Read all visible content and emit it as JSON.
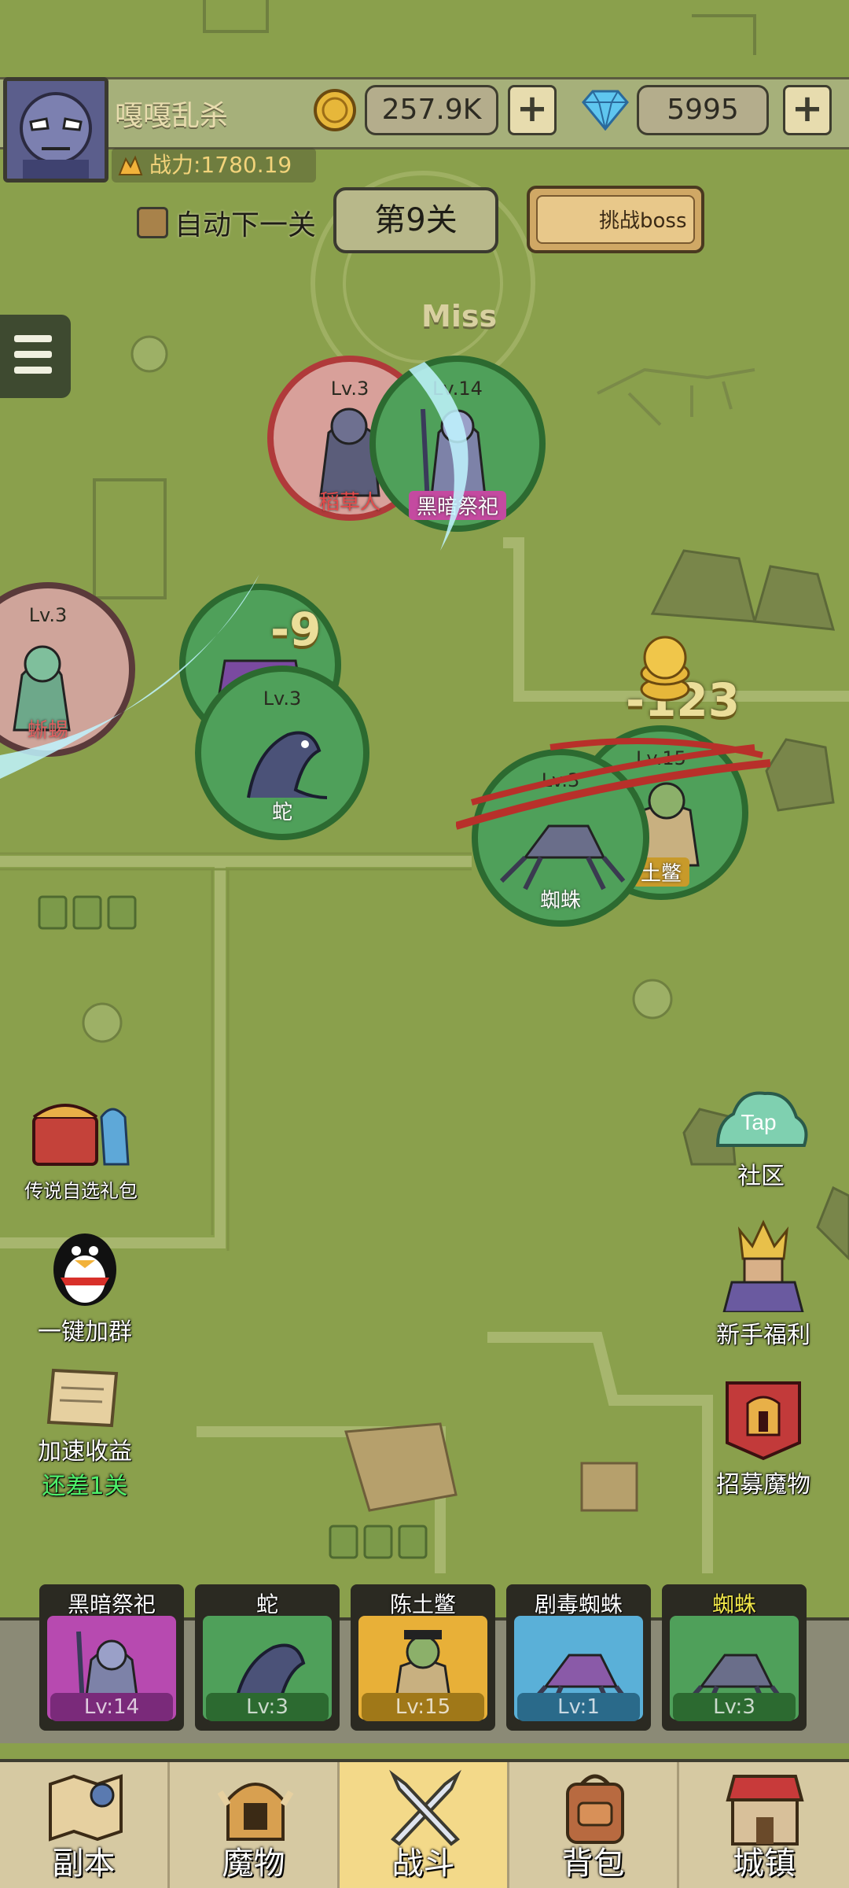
{
  "player": {
    "name": "嘎嘎乱杀",
    "power": "战力:1780.19",
    "coins": "257.9K",
    "gems": "5995",
    "plus": "+"
  },
  "stage": {
    "auto_next": "自动下一关",
    "current": "第9关",
    "boss_button": "挑战boss",
    "miss_text": "Miss"
  },
  "battle": {
    "monsters": [
      {
        "lv": "Lv.3",
        "name": "稻草人"
      },
      {
        "lv": "Lv.14",
        "name": "黑暗祭祀"
      },
      {
        "lv": "Lv.3",
        "name": "蜥蜴"
      },
      {
        "lv": "Lv.3",
        "name": "蛇"
      },
      {
        "lv": "Lv.15",
        "name": "土鳖"
      },
      {
        "lv": "Lv.3",
        "name": "蜘蛛"
      }
    ],
    "damage": [
      "-9",
      "-123"
    ]
  },
  "side_left": [
    {
      "label": "传说自选礼包"
    },
    {
      "label": "一键加群"
    },
    {
      "label": "加速收益",
      "sub": "还差1关"
    }
  ],
  "side_right": [
    {
      "label": "社区",
      "badge": "Tap"
    },
    {
      "label": "新手福利"
    },
    {
      "label": "招募魔物"
    }
  ],
  "team": [
    {
      "name": "黑暗祭祀",
      "lv": "Lv:14"
    },
    {
      "name": "蛇",
      "lv": "Lv:3"
    },
    {
      "name": "陈土鳖",
      "lv": "Lv:15"
    },
    {
      "name": "剧毒蜘蛛",
      "lv": "Lv:1"
    },
    {
      "name": "蜘蛛",
      "lv": "Lv:3"
    }
  ],
  "nav": [
    "副本",
    "魔物",
    "战斗",
    "背包",
    "城镇"
  ],
  "colors": {
    "map": "#8aa04c",
    "accent": "#f3d989",
    "enemy_ring": "#c74545",
    "ally_ring": "#3b7a3b"
  }
}
